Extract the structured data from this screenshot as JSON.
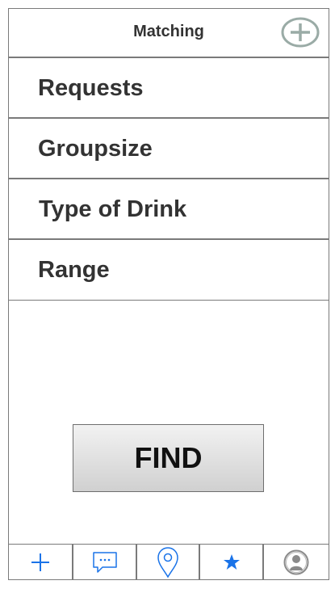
{
  "header": {
    "title": "Matching",
    "add_icon": "plus-circle-icon"
  },
  "menu": {
    "items": [
      {
        "label": "Requests"
      },
      {
        "label": "Groupsize"
      },
      {
        "label": "Type of Drink"
      },
      {
        "label": "Range"
      }
    ]
  },
  "find_button": {
    "label": "FIND"
  },
  "tabbar": {
    "tabs": [
      {
        "icon": "plus-icon"
      },
      {
        "icon": "chat-bubble-icon"
      },
      {
        "icon": "location-pin-icon"
      },
      {
        "icon": "star-icon"
      },
      {
        "icon": "user-icon"
      }
    ]
  },
  "colors": {
    "accent": "#1a73e8",
    "border": "#7a7a7a",
    "add_icon": "#9aaba6"
  }
}
